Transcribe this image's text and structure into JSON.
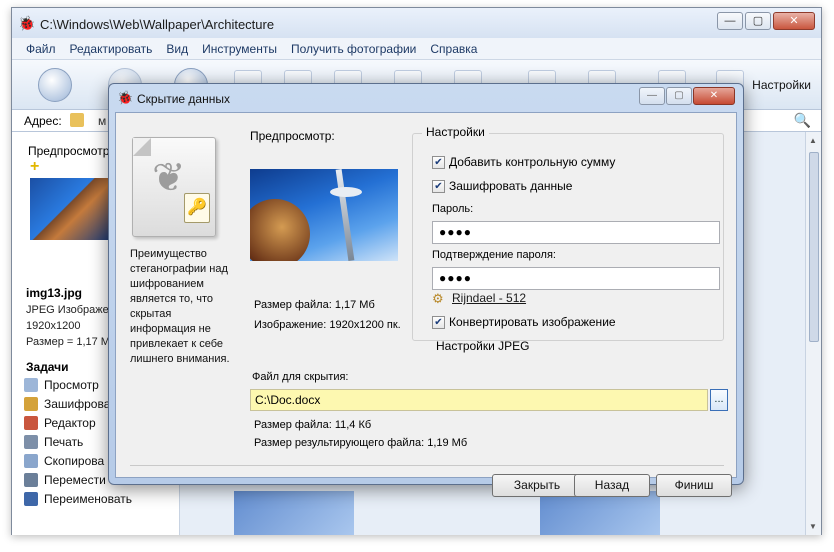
{
  "main_window": {
    "title": "C:\\Windows\\Web\\Wallpaper\\Architecture",
    "menu": [
      "Файл",
      "Редактировать",
      "Вид",
      "Инструменты",
      "Получить фотографии",
      "Справка"
    ],
    "toolbar_settings_label": "Настройки",
    "address_label": "Адрес:",
    "address_text": "м",
    "left_panel": {
      "preview_title": "Предпросмотр",
      "file_name": "img13.jpg",
      "file_type": "JPEG Изображен",
      "resolution": "1920x1200",
      "size": "Размер = 1,17 М",
      "tasks_title": "Задачи",
      "tasks": [
        "Просмотр",
        "Зашифрова",
        "Редактор",
        "Печать",
        "Скопирова",
        "Перемести",
        "Переименовать"
      ]
    }
  },
  "dialog": {
    "title": "Скрытие данных",
    "description": "Преимущество стеганографии над шифрованием является то, что скрытая информация не привлекает к себе лишнего внимания.",
    "preview_label": "Предпросмотр:",
    "file_size": "Размер файла: 1,17 Мб",
    "image_dimensions": "Изображение: 1920x1200 пк.",
    "settings": {
      "legend": "Настройки",
      "checksum_label": "Добавить контрольную сумму",
      "checksum_checked": true,
      "encrypt_label": "Зашифровать данные",
      "encrypt_checked": true,
      "password_label": "Пароль:",
      "password_value": "●●●●",
      "confirm_label": "Подтверждение пароля:",
      "confirm_value": "●●●●",
      "algorithm_link": "Rijndael - 512",
      "convert_label": "Конвертировать изображение",
      "convert_checked": true,
      "jpeg_settings_label": "Настройки JPEG"
    },
    "file_to_hide_label": "Файл для скрытия:",
    "file_to_hide_value": "C:\\Doc.docx",
    "browse_label": "...",
    "hidden_file_size": "Размер файла: 11,4 Кб",
    "result_file_size": "Размер результирующего файла: 1,19 Мб",
    "buttons": {
      "close": "Закрыть",
      "back": "Назад",
      "finish": "Финиш"
    }
  }
}
